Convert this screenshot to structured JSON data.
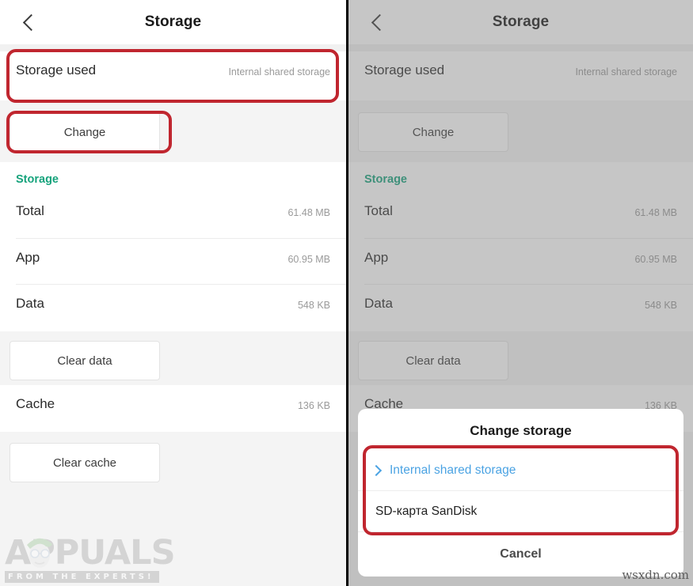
{
  "meta": {
    "watermark_left": "APPUALS",
    "watermark_left_tagline": "FROM THE EXPERTS!",
    "watermark_right": "wsxdn.com",
    "accent_teal": "#16a37c",
    "accent_blue": "#4ba3e3",
    "annotation_red": "#c0262f"
  },
  "appbar": {
    "title": "Storage",
    "back_icon": "chevron-left-icon"
  },
  "storage_used": {
    "label": "Storage used",
    "value": "Internal shared storage"
  },
  "change_button": {
    "label": "Change"
  },
  "section": {
    "header": "Storage",
    "rows": [
      {
        "label": "Total",
        "value": "61.48 MB"
      },
      {
        "label": "App",
        "value": "60.95 MB"
      },
      {
        "label": "Data",
        "value": "548 KB"
      }
    ]
  },
  "clear_data_button": {
    "label": "Clear data"
  },
  "cache_row": {
    "label": "Cache",
    "value": "136 KB"
  },
  "clear_cache_button": {
    "label": "Clear cache"
  },
  "dialog": {
    "title": "Change storage",
    "options": [
      {
        "label": "Internal shared storage",
        "selected": true,
        "icon": "chevron-right-icon"
      },
      {
        "label": "SD-карта SanDisk",
        "selected": false,
        "icon": ""
      }
    ],
    "cancel_label": "Cancel"
  }
}
